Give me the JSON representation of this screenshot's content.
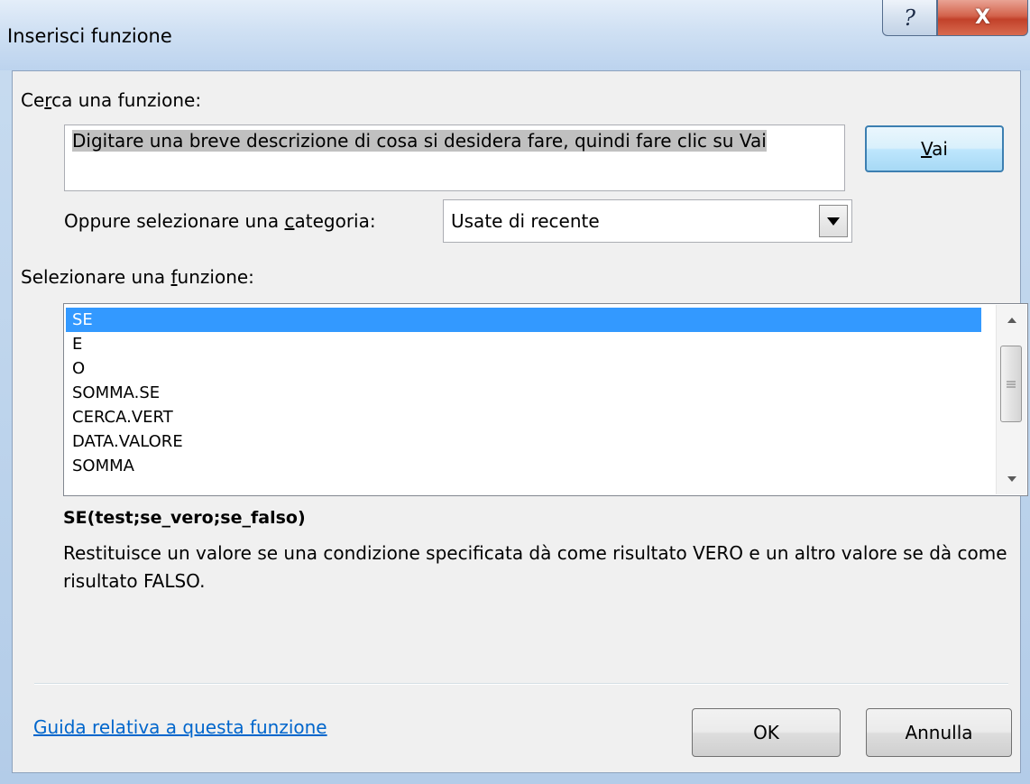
{
  "window": {
    "title": "Inserisci funzione",
    "help_glyph": "?",
    "close_glyph": "X"
  },
  "search": {
    "label_pre": "Ce",
    "label_key": "r",
    "label_post": "ca una funzione:",
    "value": "Digitare una breve descrizione di cosa si desidera fare, quindi fare clic su Vai",
    "go_button_key": "V",
    "go_button_rest": "ai"
  },
  "category": {
    "label_pre": "Oppure selezionare una ",
    "label_key": "c",
    "label_post": "ategoria:",
    "selected": "Usate di recente"
  },
  "functions": {
    "label_pre": "Selezionare una ",
    "label_key": "f",
    "label_post": "unzione:",
    "items": [
      "SE",
      "E",
      "O",
      "SOMMA.SE",
      "CERCA.VERT",
      "DATA.VALORE",
      "SOMMA"
    ],
    "selected_index": 0
  },
  "details": {
    "signature": "SE(test;se_vero;se_falso)",
    "description": "Restituisce un valore se una condizione specificata dà come risultato VERO e un altro valore se dà come risultato FALSO."
  },
  "footer": {
    "help_link": "Guida relativa a questa funzione",
    "ok_label": "OK",
    "cancel_label": "Annulla"
  },
  "colors": {
    "selection": "#3399ff",
    "link": "#0066cc",
    "close_button": "#c2412a"
  },
  "icons": {
    "help": "question-mark-icon",
    "close": "close-x-icon",
    "dropdown": "triangle-down-icon",
    "scroll_up": "triangle-up-icon",
    "scroll_down": "triangle-down-icon",
    "scroll_grip": "grip-lines-icon"
  }
}
